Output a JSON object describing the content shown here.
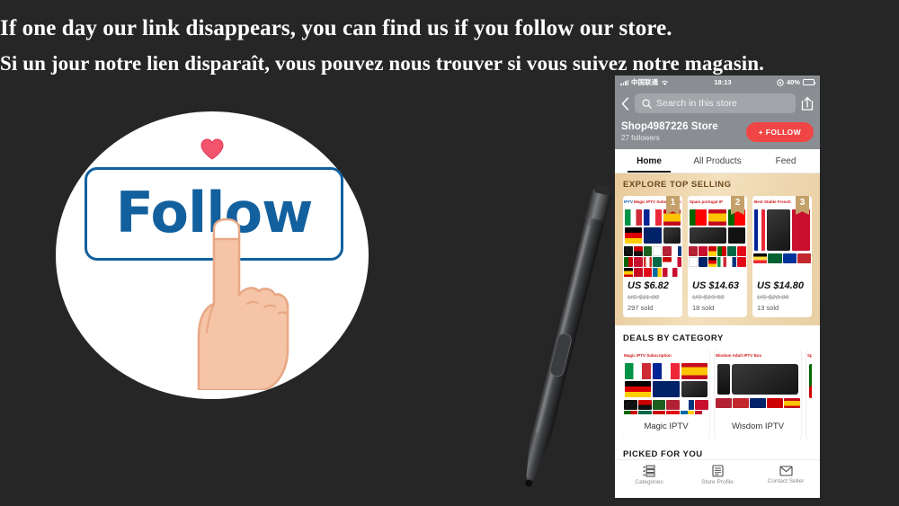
{
  "banner": {
    "line_en": "If one day our link disappears, you can find us if you follow our store.",
    "line_fr": "Si un jour notre lien disparaît, vous pouvez nous trouver si vous suivez notre magasin.",
    "background_color": "#262626",
    "text_color": "#ffffff"
  },
  "illustration": {
    "follow_word": "Follow",
    "heart_color": "#f2546e",
    "outline_color": "#12609e",
    "circle_color": "#ffffff",
    "hand_color": "#f6c5a8"
  },
  "phone": {
    "status_bar": {
      "carrier": "中国联通",
      "time": "18:13",
      "battery_percent": "40%",
      "battery_level": 40
    },
    "header": {
      "search_placeholder": "Search in this store",
      "store_name": "Shop4987226 Store",
      "followers": "27  followers",
      "follow_button": "+ FOLLOW",
      "follow_button_color": "#f14545",
      "header_color": "#8a8e93"
    },
    "tabs": [
      {
        "label": "Home",
        "active": true
      },
      {
        "label": "All Products",
        "active": false
      },
      {
        "label": "Feed",
        "active": false
      }
    ],
    "top_selling": {
      "title": "EXPLORE TOP SELLING",
      "products": [
        {
          "rank": "1",
          "banner_brand": "IPTV",
          "banner_text": "Magic IPTV Subscription",
          "price": "US $6.82",
          "price_old": "US $11.00",
          "sold": "297 sold"
        },
        {
          "rank": "2",
          "banner_brand": "",
          "banner_text": "Spain portugal IP",
          "price": "US $14.63",
          "price_old": "US $19.50",
          "sold": "18 sold"
        },
        {
          "rank": "3",
          "banner_brand": "",
          "banner_text": "Best Stable  French",
          "price": "US $14.80",
          "price_old": "US $20.00",
          "sold": "13 sold"
        }
      ]
    },
    "categories": {
      "title": "DEALS BY CATEGORY",
      "items": [
        {
          "label": "Magic IPTV",
          "banner_text": "Magic IPTV Subscription"
        },
        {
          "label": "Wisdom IPTV",
          "banner_text": "Wisdom Adult IPTV Box"
        },
        {
          "label": "",
          "banner_text": "Sp"
        }
      ]
    },
    "picked_for_you": {
      "title": "PICKED FOR YOU"
    },
    "bottom_nav": [
      {
        "label": "Categories",
        "icon": "list-icon"
      },
      {
        "label": "Store Profile",
        "icon": "document-icon"
      },
      {
        "label": "Contact Seller",
        "icon": "envelope-icon"
      }
    ]
  }
}
